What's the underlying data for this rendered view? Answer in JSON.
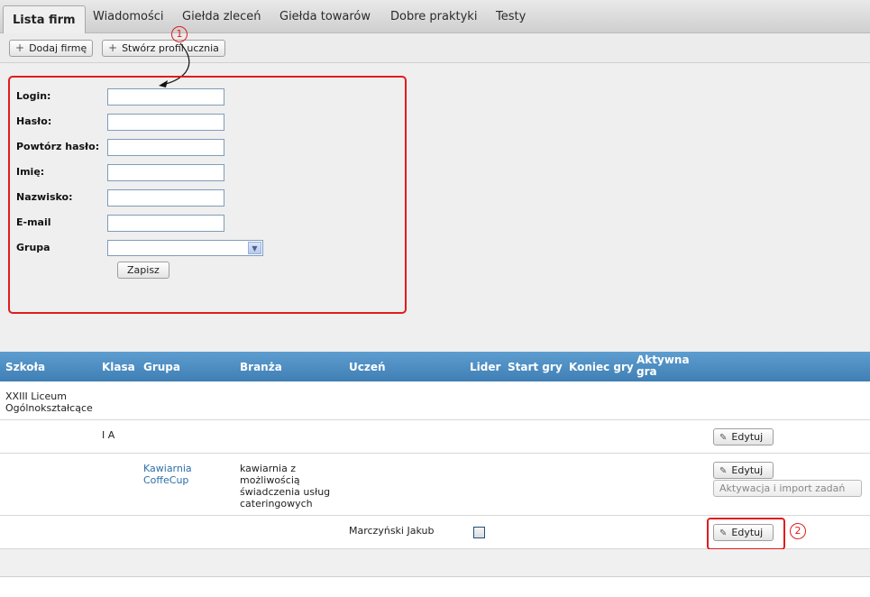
{
  "tabs": [
    {
      "label": "Lista firm",
      "active": true
    },
    {
      "label": "Wiadomości",
      "active": false
    },
    {
      "label": "Giełda zleceń",
      "active": false
    },
    {
      "label": "Giełda towarów",
      "active": false
    },
    {
      "label": "Dobre praktyki",
      "active": false
    },
    {
      "label": "Testy",
      "active": false
    }
  ],
  "toolbar": {
    "add_company_label": "Dodaj firmę",
    "create_student_label": "Stwórz profil ucznia"
  },
  "form": {
    "fields": [
      {
        "label": "Login:",
        "value": ""
      },
      {
        "label": "Hasło:",
        "value": ""
      },
      {
        "label": "Powtórz hasło:",
        "value": ""
      },
      {
        "label": "Imię:",
        "value": ""
      },
      {
        "label": "Nazwisko:",
        "value": ""
      },
      {
        "label": "E-mail",
        "value": ""
      }
    ],
    "group_label": "Grupa",
    "group_value": "",
    "save_label": "Zapisz"
  },
  "markers": {
    "one": "1",
    "two": "2"
  },
  "table": {
    "headers": {
      "school": "Szkoła",
      "class": "Klasa",
      "group": "Grupa",
      "industry": "Branża",
      "student": "Uczeń",
      "leader": "Lider",
      "start": "Start gry",
      "end": "Koniec gry",
      "active_game": "Aktywna gra"
    },
    "rows": {
      "school": {
        "name": "XXIII Liceum Ogólnokształcące"
      },
      "class": {
        "name": "I A",
        "edit_label": "Edytuj"
      },
      "group": {
        "name": "Kawiarnia CoffeCup",
        "industry": "kawiarnia z możliwością świadczenia usług cateringowych",
        "edit_label": "Edytuj",
        "activate_label": "Aktywacja i import zadań"
      },
      "student": {
        "name": "Marczyński Jakub",
        "leader": false,
        "edit_label": "Edytuj"
      }
    }
  },
  "colors": {
    "table_header": "#4a8bc0",
    "highlight": "#e01c1c",
    "link": "#2a6fa8"
  }
}
